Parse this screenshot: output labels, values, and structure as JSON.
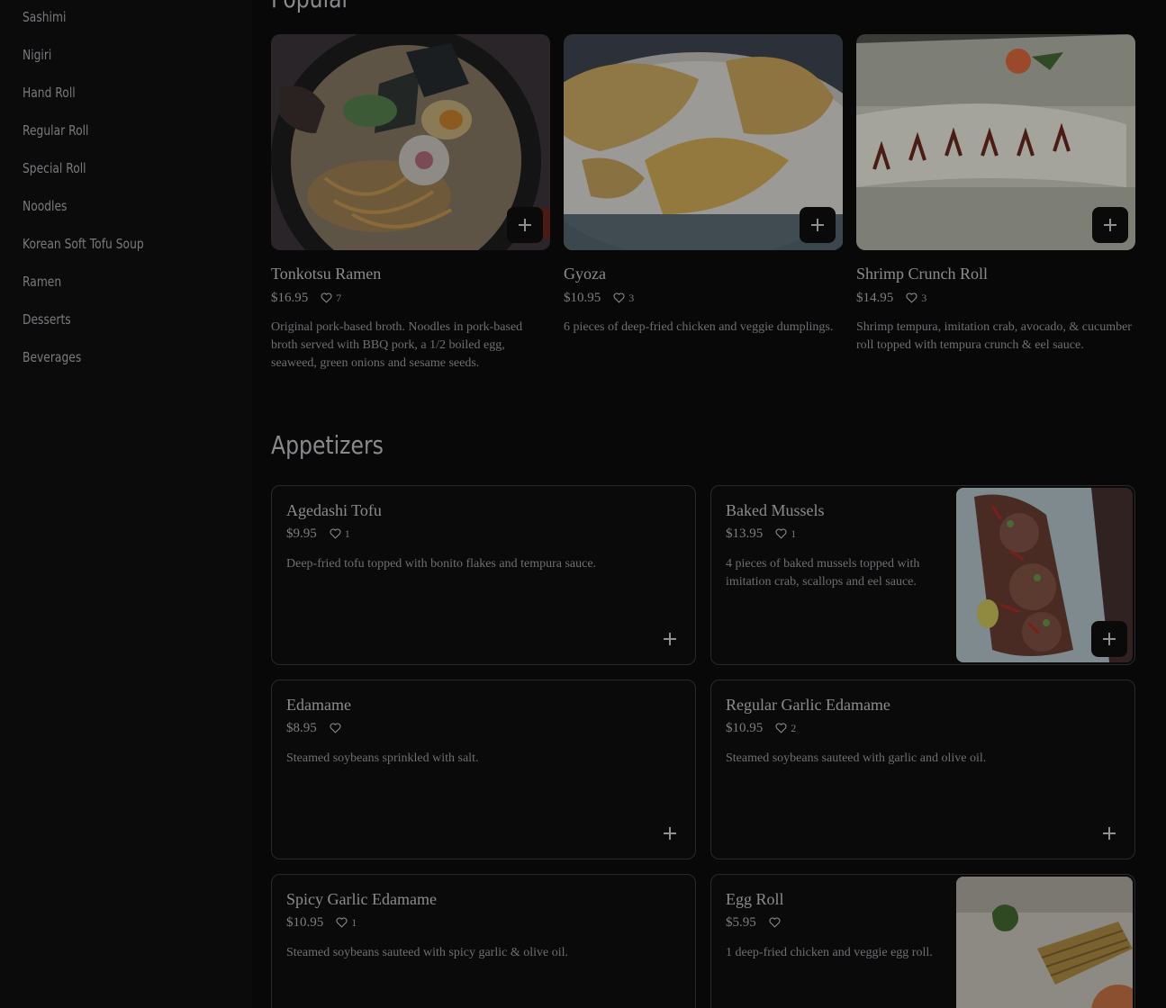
{
  "sidebar": {
    "items": [
      {
        "label": "Sashimi"
      },
      {
        "label": "Nigiri"
      },
      {
        "label": "Hand Roll"
      },
      {
        "label": "Regular Roll"
      },
      {
        "label": "Special Roll"
      },
      {
        "label": "Noodles"
      },
      {
        "label": "Korean Soft Tofu Soup"
      },
      {
        "label": "Ramen"
      },
      {
        "label": "Desserts"
      },
      {
        "label": "Beverages"
      }
    ]
  },
  "popular": {
    "title": "Popular",
    "items": [
      {
        "name": "Tonkotsu Ramen",
        "price": "$16.95",
        "likes": "7",
        "description": "Original pork-based broth. Noodles in pork-based broth served with BBQ pork, a 1/2 boiled egg, seaweed, green onions and sesame seeds."
      },
      {
        "name": "Gyoza",
        "price": "$10.95",
        "likes": "3",
        "description": "6 pieces of deep-fried chicken and veggie dumplings."
      },
      {
        "name": "Shrimp Crunch Roll",
        "price": "$14.95",
        "likes": "3",
        "description": "Shrimp tempura, imitation crab, avocado, & cucumber roll topped with tempura crunch & eel sauce."
      }
    ]
  },
  "appetizers": {
    "title": "Appetizers",
    "items": [
      {
        "name": "Agedashi Tofu",
        "price": "$9.95",
        "likes": "1",
        "description": "Deep-fried tofu topped with bonito flakes and tempura sauce."
      },
      {
        "name": "Baked Mussels",
        "price": "$13.95",
        "likes": "1",
        "description": "4 pieces of baked mussels topped with imitation crab, scallops and eel sauce."
      },
      {
        "name": "Edamame",
        "price": "$8.95",
        "likes": "",
        "description": "Steamed soybeans sprinkled with salt."
      },
      {
        "name": "Regular Garlic Edamame",
        "price": "$10.95",
        "likes": "2",
        "description": "Steamed soybeans sauteed with garlic and olive oil."
      },
      {
        "name": "Spicy Garlic Edamame",
        "price": "$10.95",
        "likes": "1",
        "description": "Steamed soybeans sauteed with spicy garlic & olive oil."
      },
      {
        "name": "Egg Roll",
        "price": "$5.95",
        "likes": "",
        "description": "1 deep-fried chicken and veggie egg roll."
      }
    ]
  },
  "icons": {
    "add": "plus-icon",
    "like": "heart-icon"
  },
  "colors": {
    "background": "#080809",
    "card_border": "#2a2a2c",
    "text": "#8c8c8f"
  }
}
